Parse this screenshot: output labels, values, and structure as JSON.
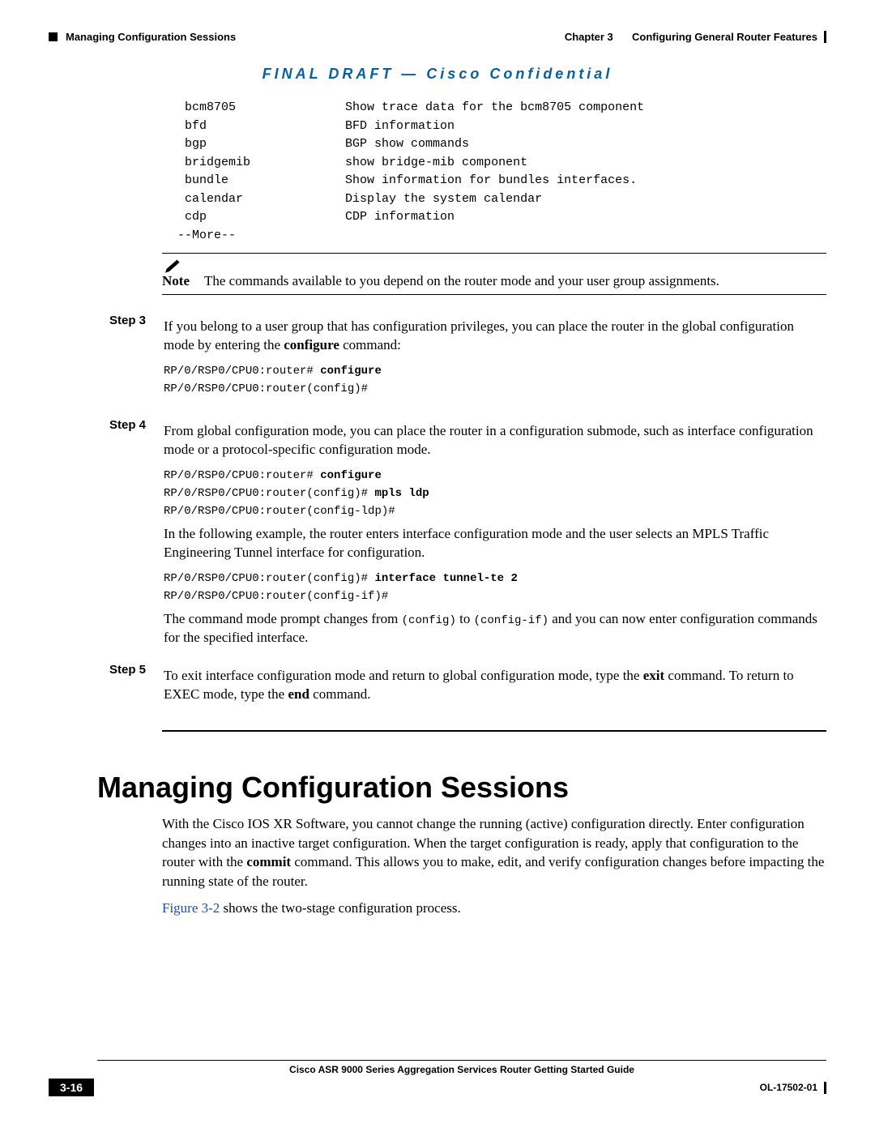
{
  "header": {
    "section": "Managing Configuration Sessions",
    "chapterLabel": "Chapter 3",
    "chapterTitle": "Configuring General Router Features"
  },
  "banner": "FINAL DRAFT — Cisco Confidential",
  "cliTable": {
    "rows": [
      {
        "cmd": "bcm8705",
        "desc": "Show trace data for the bcm8705 component"
      },
      {
        "cmd": "bfd",
        "desc": "BFD information"
      },
      {
        "cmd": "bgp",
        "desc": "BGP show commands"
      },
      {
        "cmd": "bridgemib",
        "desc": "show bridge-mib component"
      },
      {
        "cmd": "bundle",
        "desc": "Show information for bundles interfaces."
      },
      {
        "cmd": "calendar",
        "desc": "Display the system calendar"
      },
      {
        "cmd": "cdp",
        "desc": "CDP information"
      }
    ],
    "more": " --More--"
  },
  "note": {
    "label": "Note",
    "text": "The commands available to you depend on the router mode and your user group assignments."
  },
  "steps": {
    "s3": {
      "label": "Step 3",
      "para": "If you belong to a user group that has configuration privileges, you can place the router in the global configuration mode by entering the ",
      "bold": "configure",
      "para2": " command:",
      "cli1": "RP/0/RSP0/CPU0:router# ",
      "cli1b": "configure",
      "cli2": "RP/0/RSP0/CPU0:router(config)#"
    },
    "s4": {
      "label": "Step 4",
      "para": "From global configuration mode, you can place the router in a configuration submode, such as interface configuration mode or a protocol-specific configuration mode.",
      "cli1": "RP/0/RSP0/CPU0:router# ",
      "cli1b": "configure",
      "cli2": "RP/0/RSP0/CPU0:router(config)# ",
      "cli2b": "mpls ldp",
      "cli3": "RP/0/RSP0/CPU0:router(config-ldp)#",
      "mid": "In the following example, the router enters interface configuration mode and the user selects an MPLS Traffic Engineering Tunnel interface for configuration.",
      "cli4": "RP/0/RSP0/CPU0:router(config)# ",
      "cli4b": "interface tunnel-te 2",
      "cli5": "RP/0/RSP0/CPU0:router(config-if)#",
      "tail1": "The command mode prompt changes from ",
      "code1": "(config)",
      "tail2": " to ",
      "code2": "(config-if)",
      "tail3": " and you can now enter configuration commands for the specified interface."
    },
    "s5": {
      "label": "Step 5",
      "para1": "To exit interface configuration mode and return to global configuration mode, type the ",
      "b1": "exit",
      "para2": " command. To return to EXEC mode, type the ",
      "b2": "end",
      "para3": " command."
    }
  },
  "section": {
    "title": "Managing Configuration Sessions",
    "p1a": "With the Cisco IOS XR Software, you cannot change the running (active) configuration directly. Enter configuration changes into an inactive target configuration. When the target configuration is ready, apply that configuration to the router with the ",
    "p1b": "commit",
    "p1c": " command. This allows you to make, edit, and verify configuration changes before impacting the running state of the router.",
    "linkText": "Figure 3-2",
    "p2": " shows the two-stage configuration process."
  },
  "footer": {
    "guide": "Cisco ASR 9000 Series Aggregation Services Router Getting Started Guide",
    "pageNum": "3-16",
    "docId": "OL-17502-01"
  }
}
